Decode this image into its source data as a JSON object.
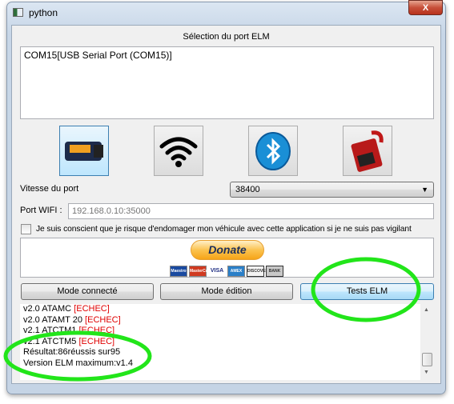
{
  "window": {
    "title": "python",
    "close_label": "X"
  },
  "port_section": {
    "title": "Sélection du port ELM",
    "ports": [
      "COM15[USB Serial Port (COM15)]"
    ]
  },
  "adapters": [
    {
      "name": "usb-obd-adapter"
    },
    {
      "name": "wifi"
    },
    {
      "name": "bluetooth"
    },
    {
      "name": "obd-cable"
    }
  ],
  "speed": {
    "label": "Vitesse du port",
    "value": "38400"
  },
  "wifi": {
    "label": "Port WIFI :",
    "placeholder": "192.168.0.10:35000"
  },
  "disclaimer": {
    "label": "Je suis conscient que je risque d'endomager mon véhicule avec cette application si je ne suis pas vigilant",
    "checked": false
  },
  "donate": {
    "label": "Donate",
    "cards": [
      "Maestro",
      "MasterCard",
      "VISA",
      "AMEX",
      "DISCOVER",
      "BANK"
    ]
  },
  "buttons": {
    "connected": "Mode connecté",
    "edit": "Mode édition",
    "tests": "Tests ELM"
  },
  "log": [
    {
      "text": "v2.0 ATAMC ",
      "status": "[ECHEC]"
    },
    {
      "text": "v2.0 ATAMT 20 ",
      "status": "[ECHEC]"
    },
    {
      "text": "v2.1 ATCTM1 ",
      "status": "[ECHEC]"
    },
    {
      "text": "v2.1 ATCTM5 ",
      "status": "[ECHEC]"
    },
    {
      "text": "Résultat:86réussis sur95",
      "status": ""
    },
    {
      "text": "Version ELM maximum:v1.4",
      "status": ""
    }
  ],
  "annotations": {
    "color": "#22e51a"
  }
}
